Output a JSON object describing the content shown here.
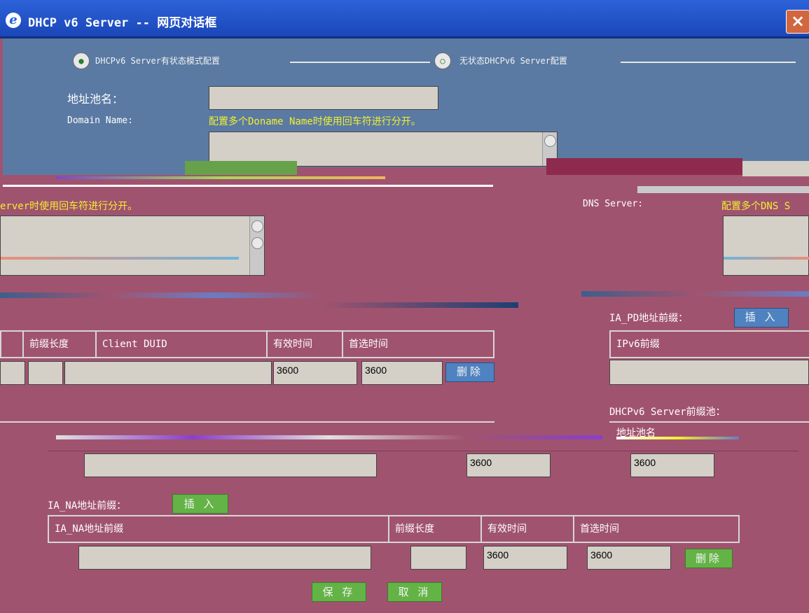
{
  "window": {
    "title": "DHCP v6 Server -- 网页对话框",
    "close": "×",
    "icon": "ie-icon"
  },
  "mode": {
    "option1": "DHCPv6 Server有状态模式配置",
    "option2": "无状态DHCPv6 Server配置"
  },
  "pool": {
    "name_label": "地址池名：",
    "name_value": ""
  },
  "domain": {
    "label": "Domain Name:",
    "note": "配置多个Doname Name时使用回车符进行分开。"
  },
  "dns_left": {
    "note_fragment": "erver时使用回车符进行分开。"
  },
  "dns_right": {
    "label": "DNS Server:",
    "note_fragment": "配置多个DNS S"
  },
  "pd": {
    "prefix_label": "IA_PD地址前缀：",
    "insert_button": "插 入",
    "table_headers": [
      "前缀长度",
      "Client DUID",
      "有效时间",
      "首选时间"
    ],
    "row": {
      "prefix_length": "",
      "client_duid": "",
      "valid_time": "3600",
      "preferred_time": "3600",
      "delete_button": "删除"
    },
    "right_header": "IPv6前缀"
  },
  "server_pool": {
    "label": "DHCPv6 Server前缀池：",
    "header_fragment": "地址池名",
    "valid_time": "3600",
    "preferred_time": "3600"
  },
  "na": {
    "prefix_label": "IA_NA地址前缀：",
    "insert_button": "插 入",
    "table_headers": [
      "IA_NA地址前缀",
      "前缀长度",
      "有效时间",
      "首选时间"
    ],
    "row": {
      "prefix": "",
      "prefix_length": "",
      "valid_time": "3600",
      "preferred_time": "3600",
      "delete_button": "删除"
    }
  },
  "footer": {
    "save_button": "保 存",
    "cancel_button": "取 消"
  },
  "colors": {
    "titlebar": "#1a47b9",
    "upper_panel": "#5a7aa3",
    "body": "#a0536f",
    "note_yellow": "#f3ef2d",
    "button_green": "#64b346",
    "button_blue": "#4f82c0"
  }
}
